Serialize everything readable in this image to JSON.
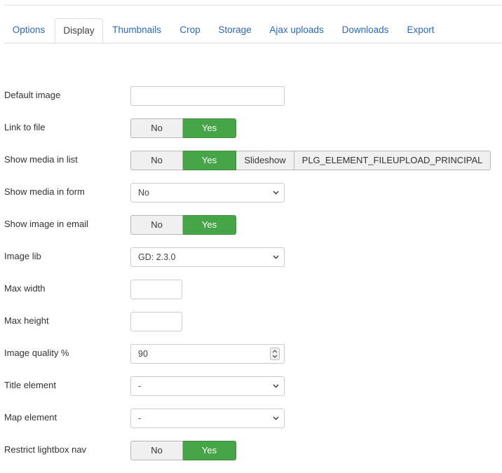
{
  "tabs": [
    "Options",
    "Display",
    "Thumbnails",
    "Crop",
    "Storage",
    "Ajax uploads",
    "Downloads",
    "Export"
  ],
  "active_tab": "Display",
  "colors": {
    "link": "#2a69b8",
    "toggle_active": "#46a546"
  },
  "fields": {
    "default_image": {
      "label": "Default image",
      "value": ""
    },
    "link_to_file": {
      "label": "Link to file",
      "options": [
        "No",
        "Yes"
      ],
      "selected": "Yes"
    },
    "show_media_in_list": {
      "label": "Show media in list",
      "options": [
        "No",
        "Yes",
        "Slideshow",
        "PLG_ELEMENT_FILEUPLOAD_PRINCIPAL"
      ],
      "selected": "Yes"
    },
    "show_media_in_form": {
      "label": "Show media in form",
      "value": "No"
    },
    "show_image_in_email": {
      "label": "Show image in email",
      "options": [
        "No",
        "Yes"
      ],
      "selected": "Yes"
    },
    "image_lib": {
      "label": "Image lib",
      "value": "GD: 2.3.0"
    },
    "max_width": {
      "label": "Max width",
      "value": ""
    },
    "max_height": {
      "label": "Max height",
      "value": ""
    },
    "image_quality": {
      "label": "Image quality %",
      "value": "90"
    },
    "title_element": {
      "label": "Title element",
      "value": "-"
    },
    "map_element": {
      "label": "Map element",
      "value": "-"
    },
    "restrict_lightbox_nav": {
      "label": "Restrict lightbox nav",
      "options": [
        "No",
        "Yes"
      ],
      "selected": "Yes"
    }
  }
}
